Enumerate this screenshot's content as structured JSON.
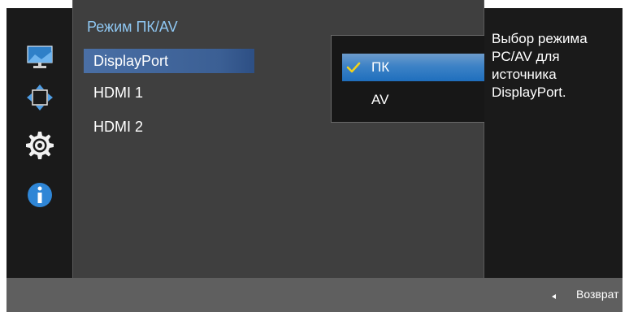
{
  "menu": {
    "title": "Режим ПК/AV",
    "items": [
      {
        "label": "DisplayPort"
      },
      {
        "label": "HDMI 1"
      },
      {
        "label": "HDMI 2"
      }
    ]
  },
  "dropdown": {
    "options": [
      {
        "label": "ПК",
        "checked": true
      },
      {
        "label": "AV",
        "checked": false
      }
    ]
  },
  "description": "Выбор режима PC/AV для источника DisplayPort.",
  "footer": {
    "back_label": "Возврат"
  },
  "icons": [
    "monitor-icon",
    "size-position-icon",
    "settings-gear-icon",
    "info-icon",
    "checkmark-icon",
    "back-arrow-icon"
  ],
  "colors": {
    "accent_title": "#8fc7f2",
    "selected_menu": "#3b5f94",
    "selected_option": "#2f7bc3",
    "check": "#f2d21b"
  }
}
